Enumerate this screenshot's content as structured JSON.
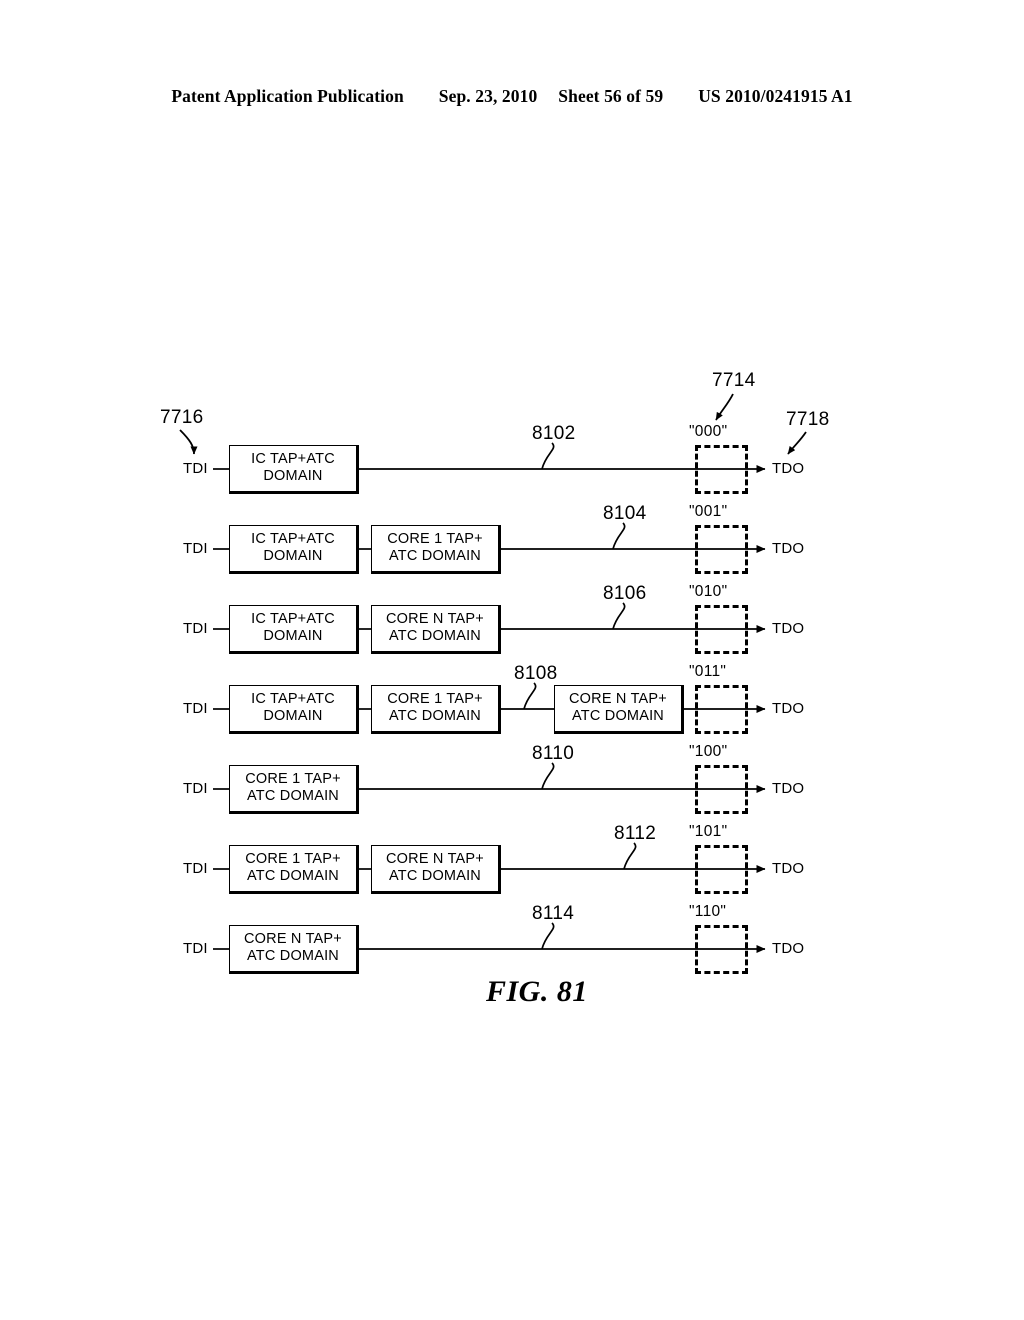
{
  "header": {
    "publication": "Patent Application Publication",
    "date": "Sep. 23, 2010",
    "sheet": "Sheet 56 of 59",
    "patent_number": "US 2010/0241915 A1"
  },
  "figure": {
    "caption": "FIG. 81",
    "input_label": "TDI",
    "output_label": "TDO",
    "callouts": {
      "input_ref": "7716",
      "marker_ref": "7714",
      "output_ref": "7718"
    },
    "rows": [
      {
        "ref": "8102",
        "code": "\"000\"",
        "tdi": "TDI",
        "tdo": "TDO",
        "boxes": [
          {
            "line1": "IC TAP+ATC",
            "line2": "DOMAIN"
          }
        ]
      },
      {
        "ref": "8104",
        "code": "\"001\"",
        "tdi": "TDI",
        "tdo": "TDO",
        "boxes": [
          {
            "line1": "IC TAP+ATC",
            "line2": "DOMAIN"
          },
          {
            "line1": "CORE 1 TAP+",
            "line2": "ATC DOMAIN"
          }
        ]
      },
      {
        "ref": "8106",
        "code": "\"010\"",
        "tdi": "TDI",
        "tdo": "TDO",
        "boxes": [
          {
            "line1": "IC TAP+ATC",
            "line2": "DOMAIN"
          },
          {
            "line1": "CORE N TAP+",
            "line2": "ATC DOMAIN"
          }
        ]
      },
      {
        "ref": "8108",
        "code": "\"011\"",
        "tdi": "TDI",
        "tdo": "TDO",
        "boxes": [
          {
            "line1": "IC TAP+ATC",
            "line2": "DOMAIN"
          },
          {
            "line1": "CORE 1 TAP+",
            "line2": "ATC DOMAIN"
          },
          {
            "line1": "CORE N TAP+",
            "line2": "ATC DOMAIN"
          }
        ]
      },
      {
        "ref": "8110",
        "code": "\"100\"",
        "tdi": "TDI",
        "tdo": "TDO",
        "boxes": [
          {
            "line1": "CORE 1 TAP+",
            "line2": "ATC DOMAIN"
          }
        ]
      },
      {
        "ref": "8112",
        "code": "\"101\"",
        "tdi": "TDI",
        "tdo": "TDO",
        "boxes": [
          {
            "line1": "CORE 1 TAP+",
            "line2": "ATC DOMAIN"
          },
          {
            "line1": "CORE N TAP+",
            "line2": "ATC DOMAIN"
          }
        ]
      },
      {
        "ref": "8114",
        "code": "\"110\"",
        "tdi": "TDI",
        "tdo": "TDO",
        "boxes": [
          {
            "line1": "CORE N TAP+",
            "line2": "ATC DOMAIN"
          }
        ]
      }
    ]
  }
}
